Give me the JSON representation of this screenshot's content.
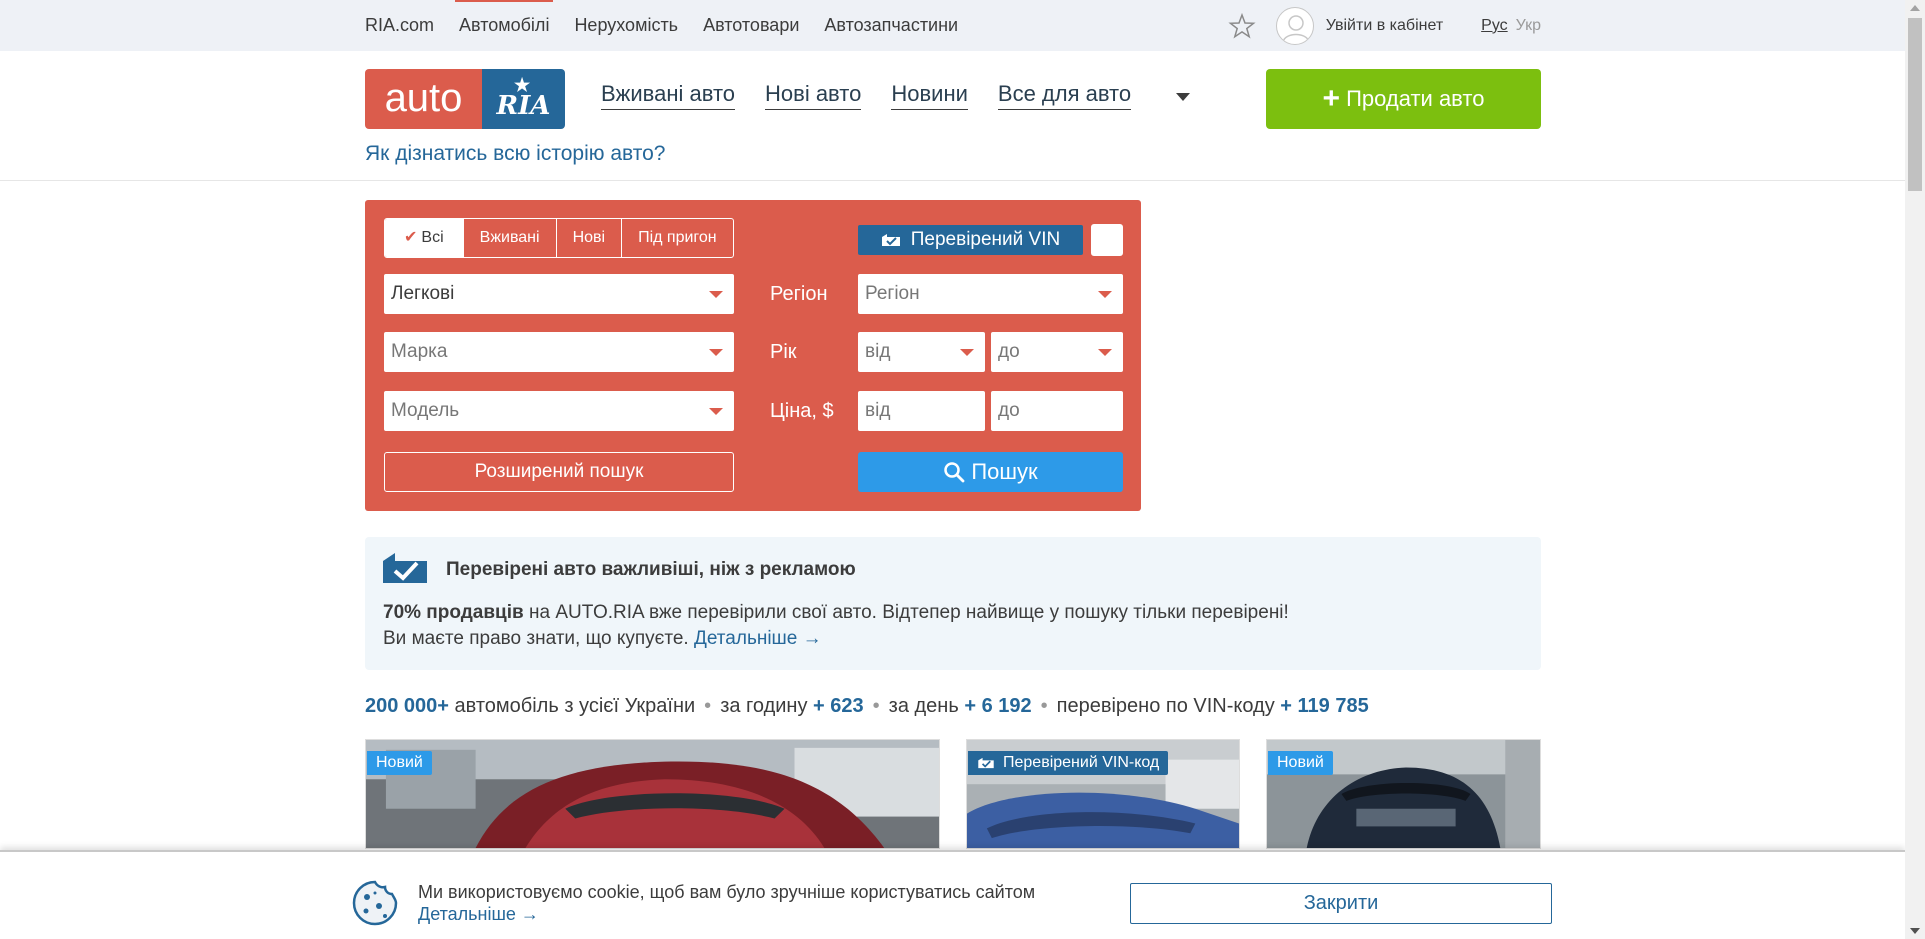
{
  "topnav": {
    "items": [
      "RIA.com",
      "Автомобілі",
      "Нерухомість",
      "Автотовари",
      "Автозапчастини"
    ],
    "login": "Увійти в кабінет",
    "lang_ru": "Рус",
    "lang_ua": "Укр"
  },
  "header": {
    "logo_left": "auto",
    "logo_right": "RIA",
    "nav": [
      "Вживані авто",
      "Нові авто",
      "Новини",
      "Все для авто"
    ],
    "sell_button": "Продати авто",
    "history_link": "Як дізнатись всю історію авто?"
  },
  "search": {
    "tabs": [
      "Всі",
      "Вживані",
      "Нові",
      "Під пригон"
    ],
    "vehicle_type": "Легкові",
    "brand_placeholder": "Марка",
    "model_placeholder": "Модель",
    "region_label": "Регіон",
    "region_placeholder": "Регіон",
    "year_label": "Рік",
    "year_from": "від",
    "year_to": "до",
    "price_label": "Ціна, $",
    "price_from": "від",
    "price_to": "до",
    "vin_badge": "Перевірений VIN",
    "advanced_button": "Розширений пошук",
    "search_button": "Пошук"
  },
  "promo": {
    "title": "Перевірені авто важливіші, ніж з рекламою",
    "bold": "70% продавців",
    "line1": " на AUTO.RIA вже перевірили свої авто. Відтепер найвище у пошуку тільки перевірені!",
    "line2": "Ви маєте право знати, що купуєте. ",
    "link": "Детальніше →"
  },
  "stats": {
    "total": "200 000+",
    "total_text": " автомобіль з усієї України",
    "hour_text": "за годину ",
    "hour_value": "+ 623",
    "day_text": "за день ",
    "day_value": "+ 6 192",
    "vin_text": "перевірено по VIN-коду ",
    "vin_value": "+ 119 785"
  },
  "cards": [
    {
      "badge": "Новий"
    },
    {
      "badge": "Перевірений VIN-код"
    },
    {
      "badge": "Новий"
    }
  ],
  "cookie": {
    "text": "Ми використовуємо cookie, щоб вам було зручніше користуватись сайтом",
    "link": "Детальніше →",
    "button": "Закрити"
  },
  "colors": {
    "accent_red": "#db5c4c",
    "brand_blue": "#256799",
    "sell_green": "#7cbf0f",
    "search_blue": "#2d9ae8"
  }
}
